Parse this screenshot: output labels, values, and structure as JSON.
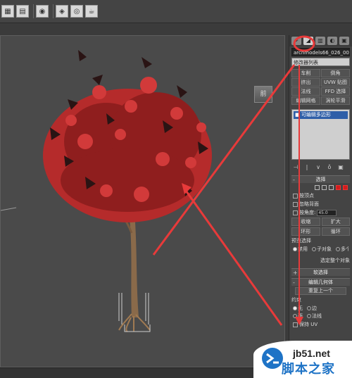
{
  "toolbar": {
    "buttons": [
      "render-frame-icon",
      "render-setup-icon",
      "render-icon",
      "material-editor-icon",
      "environment-icon",
      "teapot-icon"
    ]
  },
  "viewport": {
    "view_cube_label": "前"
  },
  "command_panel": {
    "tabs": [
      "create-icon",
      "modify-icon",
      "hierarchy-icon",
      "motion-icon",
      "display-icon",
      "utilities-icon"
    ],
    "object_name": "archmodels66_026_002",
    "modifier_list": "修改器列表",
    "modifier_buttons": [
      "车削",
      "倒角",
      "挤出",
      "UVW 贴图",
      "法线",
      "FFD 选择",
      "编辑网格",
      "涡轮平滑"
    ],
    "stack_item": "可编辑多边形",
    "selection": {
      "title": "选择",
      "checkbox_vertex": "按顶点",
      "checkbox_backface": "忽略背面",
      "checkbox_angle": "按角度:",
      "angle_value": "45.0",
      "shrink": "收缩",
      "grow": "扩大",
      "ring": "环形",
      "loop": "循环",
      "preview_label": "预览选择",
      "preview_off": "禁用",
      "preview_sub": "子对象",
      "preview_multi": "多个",
      "status": "选定整个对象"
    },
    "soft_selection": "软选择",
    "edit_geometry": {
      "title": "编辑几何体",
      "repeat_last": "重复上一个",
      "constraints_label": "约束",
      "none": "无",
      "edge": "边",
      "face": "面",
      "normal": "法线",
      "preserve_uv": "保持 UV"
    }
  },
  "watermark": {
    "site": "jb51.net",
    "name": "脚本之家"
  },
  "annotation_color": "#e83a3a"
}
